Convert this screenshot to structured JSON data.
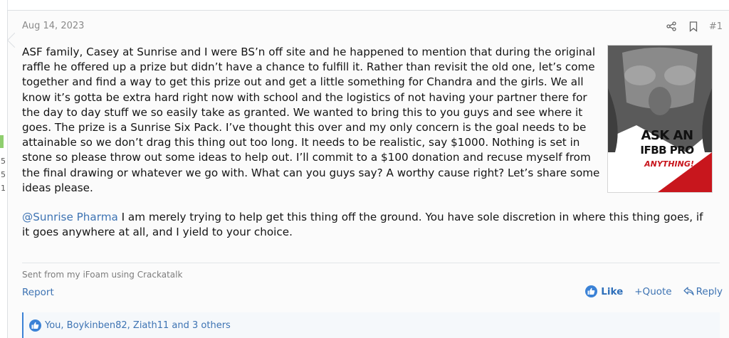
{
  "left_column": {
    "digits": [
      "5",
      "5",
      "1"
    ]
  },
  "post": {
    "date": "Aug 14, 2023",
    "number": "#1",
    "paragraph1": "ASF family, Casey at Sunrise and I were BS’n off site and he happened to mention that during the original raffle he offered up a prize but didn’t have a chance to fulfill it. Rather than revisit the old one, let’s come together and find a way to get this prize out and get a little something for Chandra and the girls. We all know it’s gotta be extra hard right now with school and the logistics of not having your partner there for the day to day stuff we so easily take as granted. We wanted to bring this to you guys and see where it goes. The prize is a Sunrise Six Pack. I’ve thought this over and my only concern is the goal needs to be attainable so we don’t drag this thing out too long. It needs to be realistic, say $1000. Nothing is set in stone so please throw out some ideas to help out. I’ll commit to a $100 donation and recuse myself from the final drawing or whatever we go with. What can you guys say? A worthy cause right? Let’s share some ideas please.",
    "mention": "@Sunrise Pharma",
    "paragraph2": " I am merely trying to help get this thing off the ground. You have sole discretion in where this thing goes, if it goes anywhere at all, and I yield to your choice.",
    "ad_image": {
      "line1": "ASK AN",
      "line2": "IFBB PRO",
      "line3": "ANYTHING!"
    },
    "signature": "Sent from my iFoam using Crackatalk",
    "report_label": "Report",
    "like_label": "Like",
    "quote_label": "+Quote",
    "reply_label": "Reply",
    "reactions_text": "You, Boykinben82, Ziath11 and 3 others"
  },
  "colors": {
    "link": "#3d73b3",
    "like_blue": "#3b82d6",
    "ad_red": "#c8161d"
  },
  "icons": {
    "share": "share-icon",
    "bookmark": "bookmark-icon",
    "like": "thumbs-up-icon",
    "reply": "reply-icon"
  }
}
